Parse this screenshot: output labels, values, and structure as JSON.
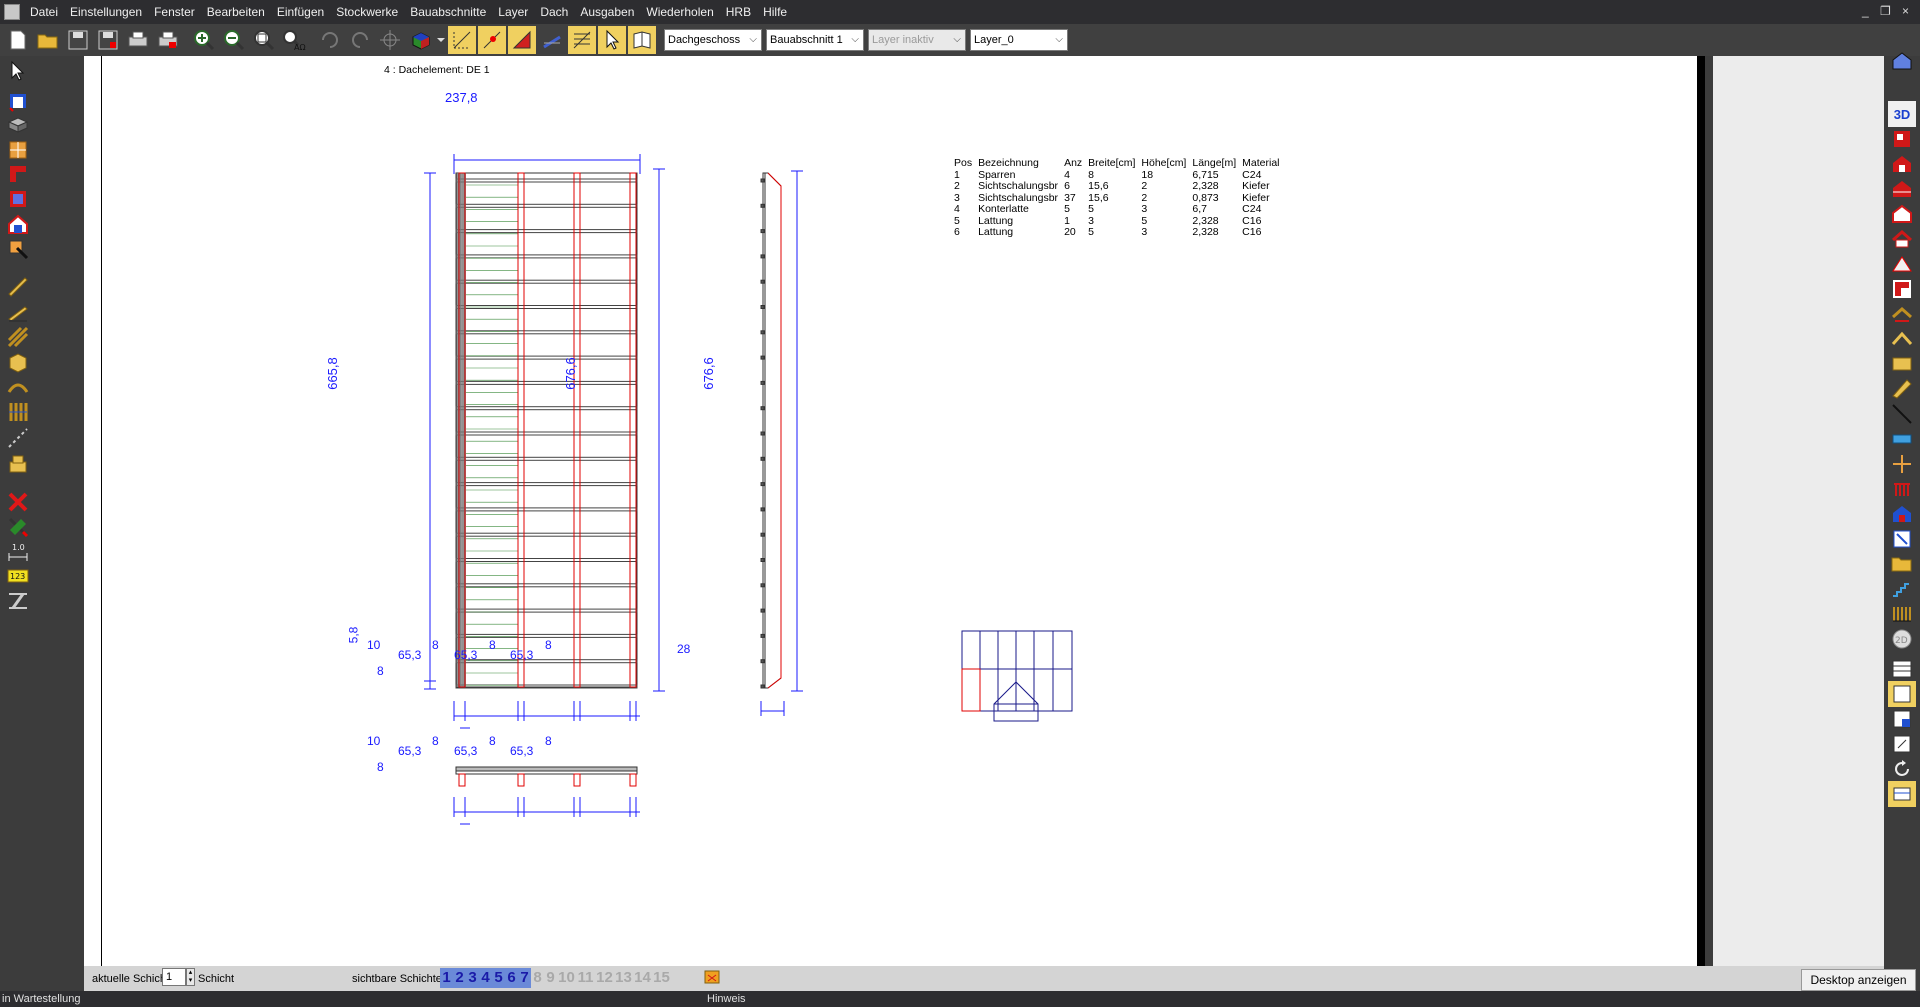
{
  "menubar": {
    "items": [
      "Datei",
      "Einstellungen",
      "Fenster",
      "Bearbeiten",
      "Einfügen",
      "Stockwerke",
      "Bauabschnitte",
      "Layer",
      "Dach",
      "Ausgaben",
      "Wiederholen",
      "HRB",
      "Hilfe"
    ],
    "window_controls": {
      "minimize": "_",
      "restore": "❐",
      "close": "×"
    }
  },
  "toolbar": {
    "floor_select": "Dachgeschoss",
    "section_select": "Bauabschnitt 1",
    "layer_inactive_select": "Layer inaktiv",
    "layer_select": "Layer_0"
  },
  "drawing": {
    "title": "4 : Dachelement: DE 1",
    "dimensions": {
      "top_width": "237,8",
      "left_height": "665,8",
      "right_height": "676,6",
      "side_height": "676,6",
      "bottom_offset": "5,8",
      "side_depth": "28",
      "bottom_chain": [
        "10",
        "8",
        "65,3",
        "8",
        "65,3",
        "8",
        "65,3",
        "8"
      ],
      "bottom_sub": "8",
      "section_chain": [
        "10",
        "8",
        "65,3",
        "8",
        "65,3",
        "8",
        "65,3",
        "8"
      ],
      "section_sub": "8"
    }
  },
  "parts_table": {
    "headers": [
      "Pos",
      "Bezeichnung",
      "Anz",
      "Breite[cm]",
      "Höhe[cm]",
      "Länge[m]",
      "Material"
    ],
    "rows": [
      [
        "1",
        "Sparren",
        "4",
        "8",
        "18",
        "6,715",
        "C24"
      ],
      [
        "2",
        "Sichtschalungsbr",
        "6",
        "15,6",
        "2",
        "2,328",
        "Kiefer"
      ],
      [
        "3",
        "Sichtschalungsbr",
        "37",
        "15,6",
        "2",
        "0,873",
        "Kiefer"
      ],
      [
        "4",
        "Konterlatte",
        "5",
        "5",
        "3",
        "6,7",
        "C24"
      ],
      [
        "5",
        "Lattung",
        "1",
        "3",
        "5",
        "2,328",
        "C16"
      ],
      [
        "6",
        "Lattung",
        "20",
        "5",
        "3",
        "2,328",
        "C16"
      ]
    ]
  },
  "bottom": {
    "current_layer_label": "aktuelle Schicht :",
    "current_layer_value": "1",
    "layer_unit": "Schicht",
    "visible_layers_label": "sichtbare Schichten:",
    "active_layers": [
      "1",
      "2",
      "3",
      "4",
      "5",
      "6",
      "7"
    ],
    "inactive_layers": [
      "8",
      "9",
      "10",
      "11",
      "12",
      "13",
      "14",
      "15"
    ]
  },
  "status": {
    "left": "in Wartestellung",
    "center": "Hinweis",
    "desktop_tip": "Desktop anzeigen"
  },
  "colors": {
    "dim_blue": "#1a1aff",
    "red": "#e00000",
    "green_line": "#3a8a3a",
    "layer_active": "#1a1aa8",
    "layer_inactive": "#a9a9a9"
  }
}
